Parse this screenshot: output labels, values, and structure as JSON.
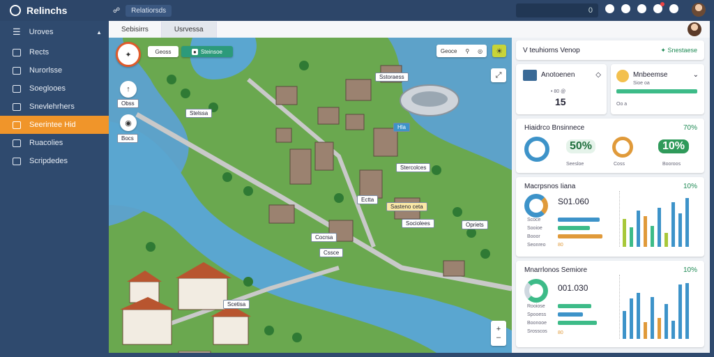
{
  "app": {
    "title": "Relinchs"
  },
  "topbar": {
    "crumb_icon": "link-icon",
    "crumb_text": "Relatiorsds",
    "search_value": "0"
  },
  "sidebar": {
    "menu_label": "Uroves",
    "items": [
      {
        "label": "Rects",
        "icon": "star-icon"
      },
      {
        "label": "Nurorlsse",
        "icon": "star-icon"
      },
      {
        "label": "Soeglooes",
        "icon": "briefcase-icon"
      },
      {
        "label": "Snevlehrhers",
        "icon": "document-icon"
      },
      {
        "label": "Seerintee Hid",
        "icon": "folder-icon"
      },
      {
        "label": "Ruacolies",
        "icon": "grid-icon"
      },
      {
        "label": "Scripdedes",
        "icon": "image-icon"
      }
    ]
  },
  "tabs": [
    {
      "label": "Sebisirrs"
    },
    {
      "label": "Usrvessa"
    }
  ],
  "map": {
    "toolbar": {
      "btn1": "Geoss",
      "btn2": "Steinsoe"
    },
    "right_ctrl": {
      "label": "Geoce",
      "icons": [
        "pin-icon",
        "target-icon"
      ]
    },
    "labels": {
      "l1": "Obss",
      "l2": "Stelssa",
      "l3": "Bocs",
      "l4": "Sstoraess",
      "l5": "Hla",
      "l6": "Stercolces",
      "l7": "Ectta",
      "l8": "Sasteno ceta",
      "l9": "Sociolees",
      "l10": "Opriets",
      "l11": "Cocrsa",
      "l12": "Cssce",
      "l13": "Scetisa"
    }
  },
  "panel": {
    "title": "V teuhiorns Venop",
    "action": "Snestaese",
    "card1": {
      "title": "Anotoenen",
      "amount": "15",
      "sub": "• 80 @"
    },
    "card2": {
      "title": "Mnbeemse",
      "sub": "Sioe oa",
      "foot": "Oo a"
    },
    "card3": {
      "title": "Hiaidrco Bnsinnece",
      "pct": "70%",
      "v1": "50%",
      "v2": "10%",
      "l1": "Seesloe",
      "l2": "Coss",
      "l3": "Booroos"
    },
    "card4": {
      "title": "Macrpsnos Iiana",
      "pct": "10%",
      "value": "S01.060",
      "rows": [
        "Scoce",
        "Sooioe",
        "Booor",
        "Seonreo"
      ],
      "foot": "80"
    },
    "card5": {
      "title": "Mnarrlonos Semiore",
      "pct": "10%",
      "value": "001.030",
      "rows": [
        "Rooiose",
        "Spooess",
        "Boonooe",
        "Srosscos"
      ],
      "foot": "80"
    }
  },
  "colors": {
    "accent": "#f0952a",
    "sidebar": "#2f4a6e",
    "green": "#1f8a55",
    "blue": "#3d93c9"
  }
}
